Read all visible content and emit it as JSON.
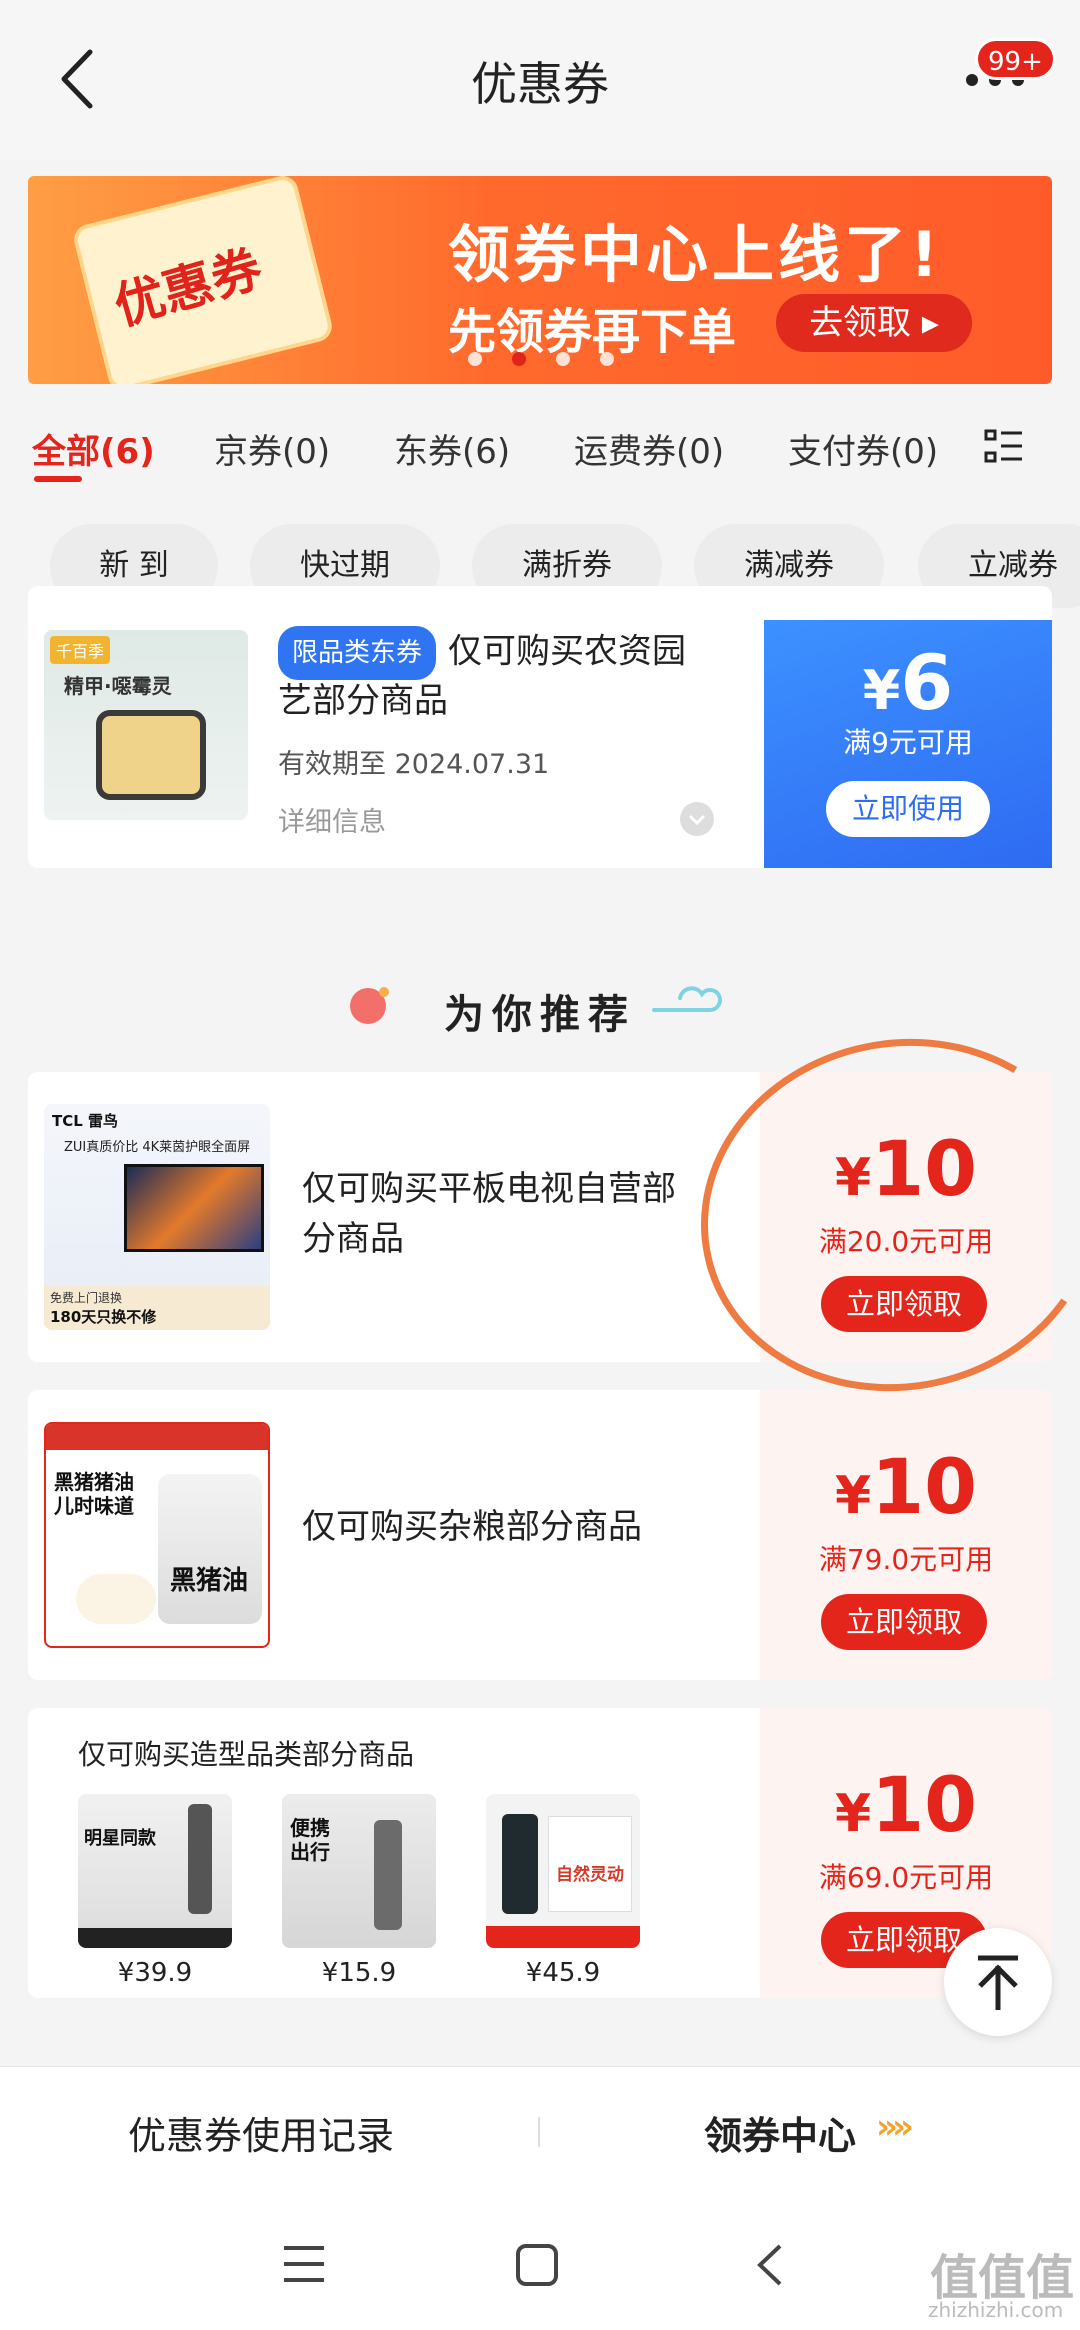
{
  "header": {
    "title": "优惠券",
    "badge": "99+"
  },
  "banner": {
    "ticket_text": "优惠券",
    "headline": "领券中心上线了!",
    "sub": "先领券再下单",
    "cta": "去领取 ▸"
  },
  "tabs": [
    {
      "label": "全部(6)",
      "active": true
    },
    {
      "label": "京券(0)"
    },
    {
      "label": "东券(6)"
    },
    {
      "label": "运费券(0)"
    },
    {
      "label": "支付券(0)"
    }
  ],
  "chips": [
    "新 到",
    "快过期",
    "满折券",
    "满减券",
    "立减券"
  ],
  "owned_coupon": {
    "tag": "限品类东券",
    "title_line1": "仅可购买农资园",
    "title_line2": "艺部分商品",
    "expiry": "有效期至 2024.07.31",
    "detail": "详细信息",
    "yen": "¥",
    "amount": "6",
    "condition": "满9元可用",
    "button": "立即使用",
    "image_caption": "精甲·噁霉灵",
    "image_badge": "千百季"
  },
  "recommend": {
    "title": "为你推荐",
    "items": [
      {
        "desc_line1": "仅可购买平板电视自营部",
        "desc_line2": "分商品",
        "yen": "¥",
        "amount": "10",
        "condition": "满20.0元可用",
        "button": "立即领取",
        "img_brand": "TCL 雷鸟",
        "img_line": "ZUI真质价比 4K莱茵护眼全面屏",
        "img_footer1": "免费上门退换",
        "img_footer2": "180天只换不修"
      },
      {
        "desc_line1": "仅可购买杂粮部分商品",
        "yen": "¥",
        "amount": "10",
        "condition": "满79.0元可用",
        "button": "立即领取",
        "img_lines": [
          "黑猪猪油",
          "儿时味道"
        ],
        "img_product": "黑猪油"
      },
      {
        "desc_line1": "仅可购买造型品类部分商品",
        "yen": "¥",
        "amount": "10",
        "condition": "满69.0元可用",
        "button": "立即领取",
        "products": [
          {
            "price": "¥39.9",
            "label": "明星同款"
          },
          {
            "price": "¥15.9",
            "label": "便携出行"
          },
          {
            "price": "¥45.9",
            "label": "自然灵动"
          }
        ]
      }
    ]
  },
  "bottom": {
    "left": "优惠券使用记录",
    "right": "领券中心",
    "arrows": "»»"
  },
  "watermark": {
    "logo": "值值值",
    "url": "zhizhizhi.com"
  },
  "colors": {
    "brand_red": "#e4251b",
    "coupon_blue": "#2f74f0",
    "annotation_orange": "#ee7b42"
  }
}
